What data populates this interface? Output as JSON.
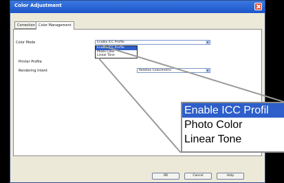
{
  "window": {
    "title": "Color Adjustment"
  },
  "tabs": [
    {
      "label": "Correction"
    },
    {
      "label": "Color Management"
    }
  ],
  "form": {
    "color_mode_label": "Color Mode",
    "color_mode_value": "Enable ICC Profile",
    "printer_profile_label": "Printer Profile",
    "rendering_intent_label": "Rendering Intent",
    "rendering_intent_value": "Relative Colorimetric"
  },
  "dropdown_options": [
    "Enable ICC Profile",
    "Photo Color",
    "Linear Tone"
  ],
  "zoom_options": [
    "Enable ICC Profil",
    "Photo Color",
    "Linear Tone"
  ],
  "buttons": {
    "ok": "OK",
    "cancel": "Cancel",
    "help": "Help"
  },
  "colors": {
    "selection": "#2d5ec9",
    "titlebar": "#1d55c9",
    "close": "#d8452f"
  }
}
